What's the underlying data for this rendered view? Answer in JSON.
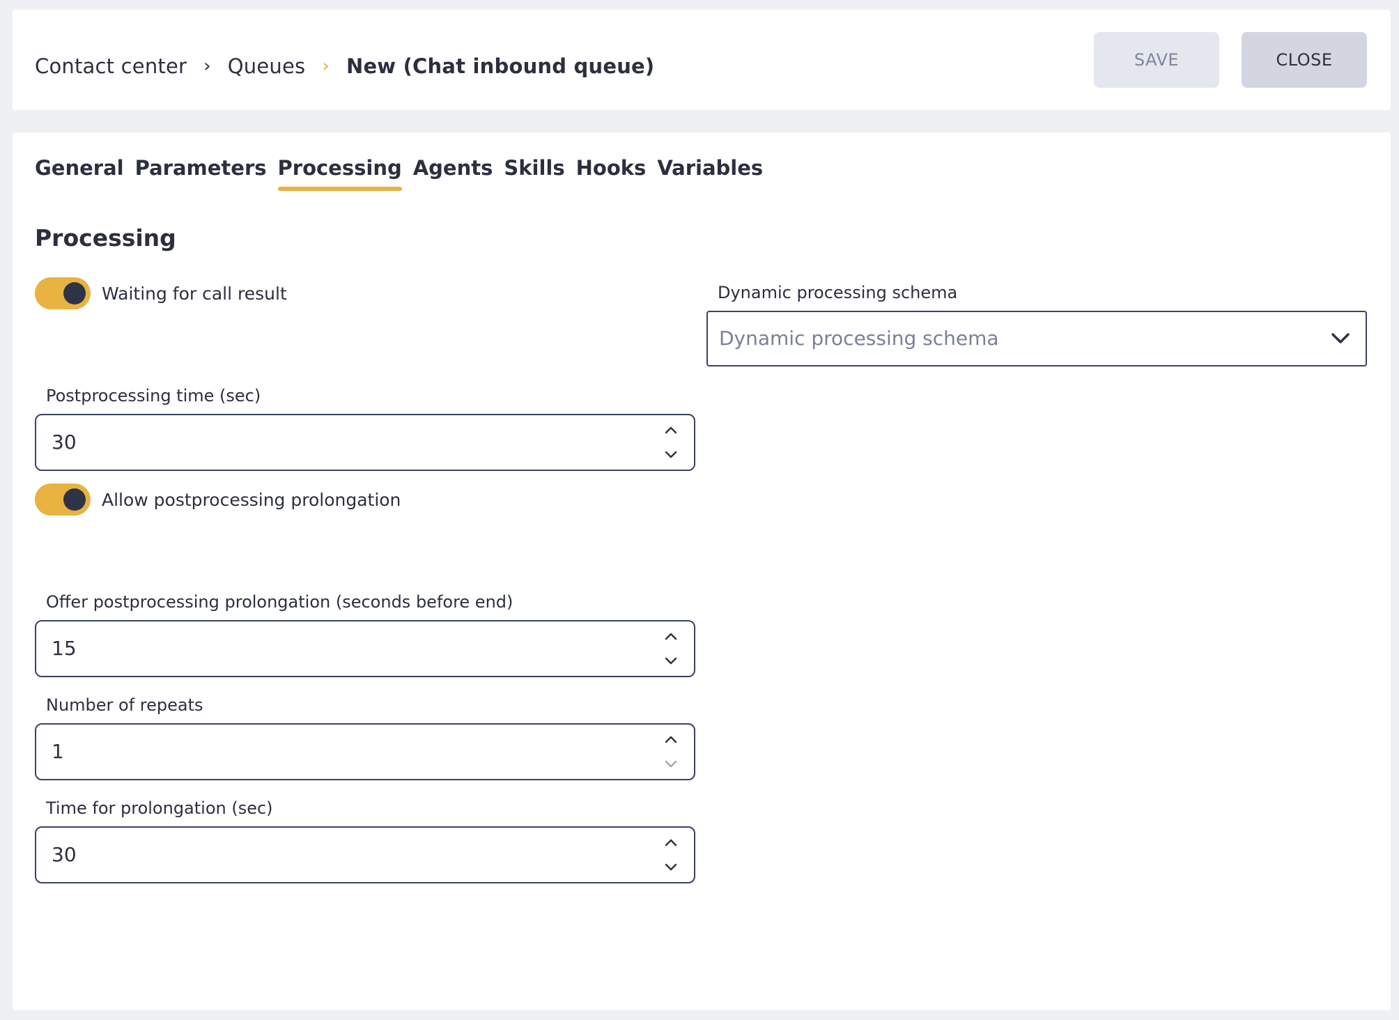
{
  "breadcrumb": {
    "items": [
      "Contact center",
      "Queues"
    ],
    "current": "New (Chat inbound queue)",
    "sep": "›"
  },
  "actions": {
    "save": "SAVE",
    "close": "CLOSE"
  },
  "tabs": [
    "General",
    "Parameters",
    "Processing",
    "Agents",
    "Skills",
    "Hooks",
    "Variables"
  ],
  "active_tab": "Processing",
  "section_title": "Processing",
  "toggles": {
    "waiting": {
      "label": "Waiting for call result",
      "on": true
    },
    "allow_prolongation": {
      "label": "Allow postprocessing prolongation",
      "on": true
    }
  },
  "dynamic_schema": {
    "label": "Dynamic processing schema",
    "placeholder": "Dynamic processing schema"
  },
  "fields": {
    "postprocessing_time": {
      "label": "Postprocessing time (sec)",
      "value": "30"
    },
    "offer_prolongation": {
      "label": "Offer postprocessing prolongation (seconds before end)",
      "value": "15"
    },
    "repeats": {
      "label": "Number of repeats",
      "value": "1"
    },
    "prolongation_time": {
      "label": "Time for prolongation (sec)",
      "value": "30"
    }
  },
  "colors": {
    "accent": "#e8b340",
    "text": "#2c2f3e",
    "border": "#3b4260"
  }
}
